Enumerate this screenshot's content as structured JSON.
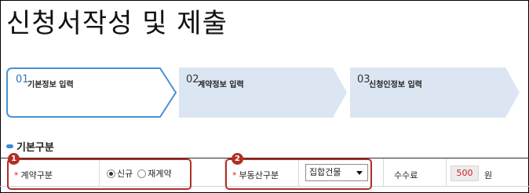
{
  "page": {
    "title": "신청서작성 및 제출"
  },
  "steps": [
    {
      "number": "01",
      "label": "기본정보 입력",
      "active": true
    },
    {
      "number": "02",
      "label": "계약정보 입력",
      "active": false
    },
    {
      "number": "03",
      "label": "신청인정보 입력",
      "active": false
    }
  ],
  "section": {
    "title": "기본구분"
  },
  "form": {
    "required_mark": "*",
    "contract_type": {
      "label": "계약구분",
      "options": [
        "신규",
        "재계약"
      ],
      "selected": "신규"
    },
    "property_type": {
      "label": "부동산구분",
      "selected": "집합건물"
    },
    "fee": {
      "label": "수수료",
      "value": "500",
      "unit": "원"
    }
  },
  "callouts": [
    "1",
    "2"
  ],
  "colors": {
    "active_step_border": "#4b90d6",
    "inactive_step_fill": "#dbe6f2",
    "callout": "#b32e24",
    "required": "#e02020",
    "fee_value": "#d02020"
  }
}
